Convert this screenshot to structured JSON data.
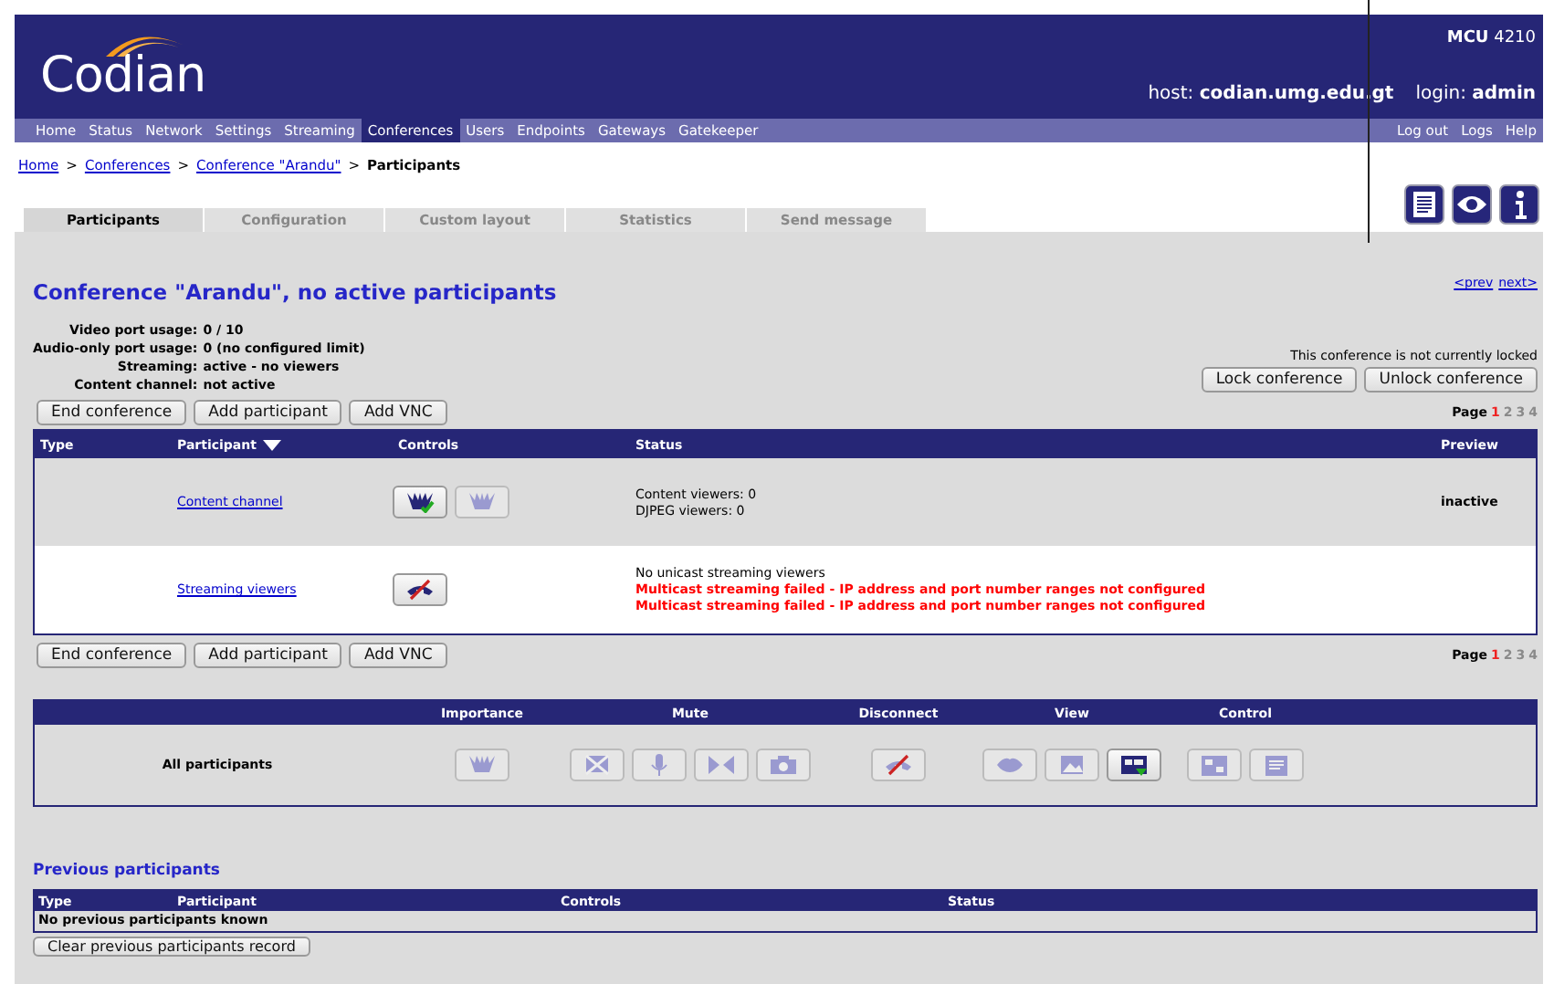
{
  "header": {
    "logo": "Codian",
    "model": "MCU",
    "model_number": "4210",
    "host_label": "host:",
    "host": "codian.umg.edu.gt",
    "login_label": "login:",
    "login": "admin"
  },
  "nav": [
    {
      "label": "Home",
      "selected": false
    },
    {
      "label": "Status",
      "selected": false
    },
    {
      "label": "Network",
      "selected": false
    },
    {
      "label": "Settings",
      "selected": false
    },
    {
      "label": "Streaming",
      "selected": false
    },
    {
      "label": "Conferences",
      "selected": true
    },
    {
      "label": "Users",
      "selected": false
    },
    {
      "label": "Endpoints",
      "selected": false
    },
    {
      "label": "Gateways",
      "selected": false
    },
    {
      "label": "Gatekeeper",
      "selected": false
    }
  ],
  "nav_right": [
    "Log out",
    "Logs",
    "Help"
  ],
  "breadcrumb": [
    {
      "label": "Home",
      "kind": "link"
    },
    {
      "label": ">",
      "kind": "sep"
    },
    {
      "label": "Conferences",
      "kind": "link"
    },
    {
      "label": ">",
      "kind": "sep"
    },
    {
      "label": "Conference \"Arandu\"",
      "kind": "link"
    },
    {
      "label": ">",
      "kind": "sep"
    },
    {
      "label": "Participants",
      "kind": "current"
    }
  ],
  "tabs": [
    {
      "label": "Participants",
      "selected": true
    },
    {
      "label": "Configuration",
      "selected": false
    },
    {
      "label": "Custom layout",
      "selected": false
    },
    {
      "label": "Statistics",
      "selected": false
    },
    {
      "label": "Send message",
      "selected": false
    }
  ],
  "tool_icons": [
    {
      "kind": "document"
    },
    {
      "kind": "eye"
    },
    {
      "kind": "info"
    }
  ],
  "title": "Conference \"Arandu\", no active participants",
  "pager_links": [
    "<prev",
    "next>"
  ],
  "usage": [
    {
      "label": "Video port usage:",
      "value": "0 / 10"
    },
    {
      "label": "Audio-only port usage:",
      "value": "0 (no configured limit)"
    },
    {
      "label": "Streaming:",
      "value": "active - no viewers"
    },
    {
      "label": "Content channel:",
      "value": "not active"
    }
  ],
  "lock_status": "This conference is not currently locked",
  "lock_buttons": [
    "Lock conference",
    "Unlock conference"
  ],
  "action_rows": [
    {
      "buttons": [
        "End conference",
        "Add participant",
        "Add VNC"
      ],
      "page_label": "Page",
      "pages": [
        {
          "label": "1",
          "selected": true
        },
        {
          "label": "2",
          "selected": false
        },
        {
          "label": "3",
          "selected": false
        },
        {
          "label": "4",
          "selected": false
        }
      ]
    },
    {
      "buttons": [
        "End conference",
        "Add participant",
        "Add VNC"
      ],
      "page_label": "Page",
      "pages": [
        {
          "label": "1",
          "selected": true
        },
        {
          "label": "2",
          "selected": false
        },
        {
          "label": "3",
          "selected": false
        },
        {
          "label": "4",
          "selected": false
        }
      ]
    }
  ],
  "participants": {
    "columns": [
      {
        "label": "Type",
        "sorted": false
      },
      {
        "label": "Participant",
        "sorted": true
      },
      {
        "label": "Controls",
        "sorted": false
      },
      {
        "label": "Status",
        "sorted": false
      },
      {
        "label": "Preview",
        "sorted": false
      }
    ],
    "rows": [
      {
        "participant": "Content channel",
        "shaded": true,
        "controls": [
          {
            "kind": "importance",
            "disabled": false
          },
          {
            "kind": "importance",
            "disabled": true
          }
        ],
        "status": [
          {
            "text": "Content viewers: 0",
            "error": false
          },
          {
            "text": "DJPEG viewers: 0",
            "error": false
          }
        ],
        "preview": "inactive"
      },
      {
        "participant": "Streaming viewers",
        "shaded": false,
        "controls": [
          {
            "kind": "disconnect",
            "disabled": false
          }
        ],
        "status": [
          {
            "text": "No unicast streaming viewers",
            "error": false
          },
          {
            "text": "Multicast streaming failed - IP address and port number ranges not configured",
            "error": true
          },
          {
            "text": "Multicast streaming failed - IP address and port number ranges not configured",
            "error": true
          }
        ]
      }
    ]
  },
  "all_participants": {
    "label": "All participants",
    "groups": [
      {
        "title": "Importance",
        "controls": [
          {
            "kind": "importance",
            "disabled": true
          }
        ]
      },
      {
        "title": "Mute",
        "controls": [
          {
            "kind": "video-mute",
            "disabled": true
          },
          {
            "kind": "microphone",
            "disabled": true
          },
          {
            "kind": "bowtie",
            "disabled": true
          },
          {
            "kind": "camera",
            "disabled": true
          }
        ]
      },
      {
        "title": "Disconnect",
        "controls": [
          {
            "kind": "disconnect",
            "disabled": true
          }
        ]
      },
      {
        "title": "View",
        "controls": [
          {
            "kind": "lips",
            "disabled": true
          },
          {
            "kind": "picture",
            "disabled": true
          },
          {
            "kind": "layout",
            "disabled": false
          }
        ]
      },
      {
        "title": "Control",
        "controls": [
          {
            "kind": "panel",
            "disabled": true
          },
          {
            "kind": "list",
            "disabled": true
          }
        ]
      }
    ]
  },
  "previous": {
    "title": "Previous participants",
    "columns": [
      "Type",
      "Participant",
      "Controls",
      "Status"
    ],
    "empty": "No previous participants known",
    "button": "Clear previous participants record"
  }
}
